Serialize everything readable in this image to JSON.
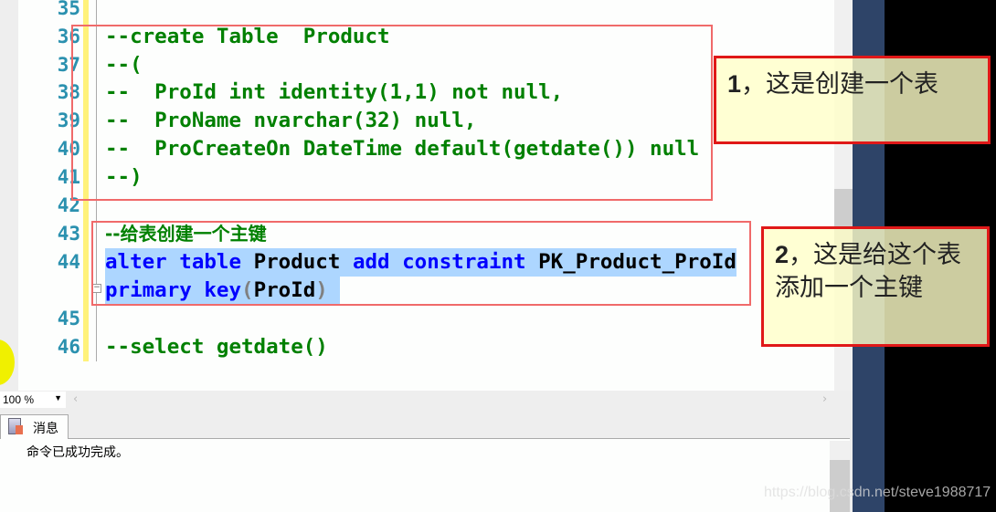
{
  "editor": {
    "line_numbers": [
      "35",
      "36",
      "37",
      "38",
      "39",
      "40",
      "41",
      "42",
      "43",
      "44",
      "45",
      "46"
    ],
    "lines": {
      "l36": "--create Table  Product",
      "l37": "--(",
      "l38": "--  ProId int identity(1,1) not null,",
      "l39": "--  ProName nvarchar(32) null,",
      "l40": "--  ProCreateOn DateTime default(getdate()) null",
      "l41": "--)",
      "l43": "--给表创建一个主键",
      "l44": {
        "k1": "alter",
        "k2": "table",
        "i1": "Product",
        "k3": "add",
        "k4": "constraint",
        "i2": "PK_Product_ProId"
      },
      "l44b": {
        "k1": "primary",
        "k2": "key",
        "p1": "(",
        "i1": "ProId",
        "p2": ")"
      },
      "l46": "--select getdate()"
    },
    "colors": {
      "comment": "#008000",
      "keyword": "#0000ff",
      "line_number": "#2b91af",
      "selection": "#add6ff"
    }
  },
  "zoom": {
    "value": "100 %"
  },
  "results": {
    "tab_label": "消息",
    "message": "命令已成功完成。"
  },
  "callouts": [
    {
      "num": "1",
      "text": "，这是创建一个表"
    },
    {
      "num": "2",
      "text": "，这是给这个表添加一个主键"
    }
  ],
  "watermark": "https://blog.csdn.net/steve1988717"
}
